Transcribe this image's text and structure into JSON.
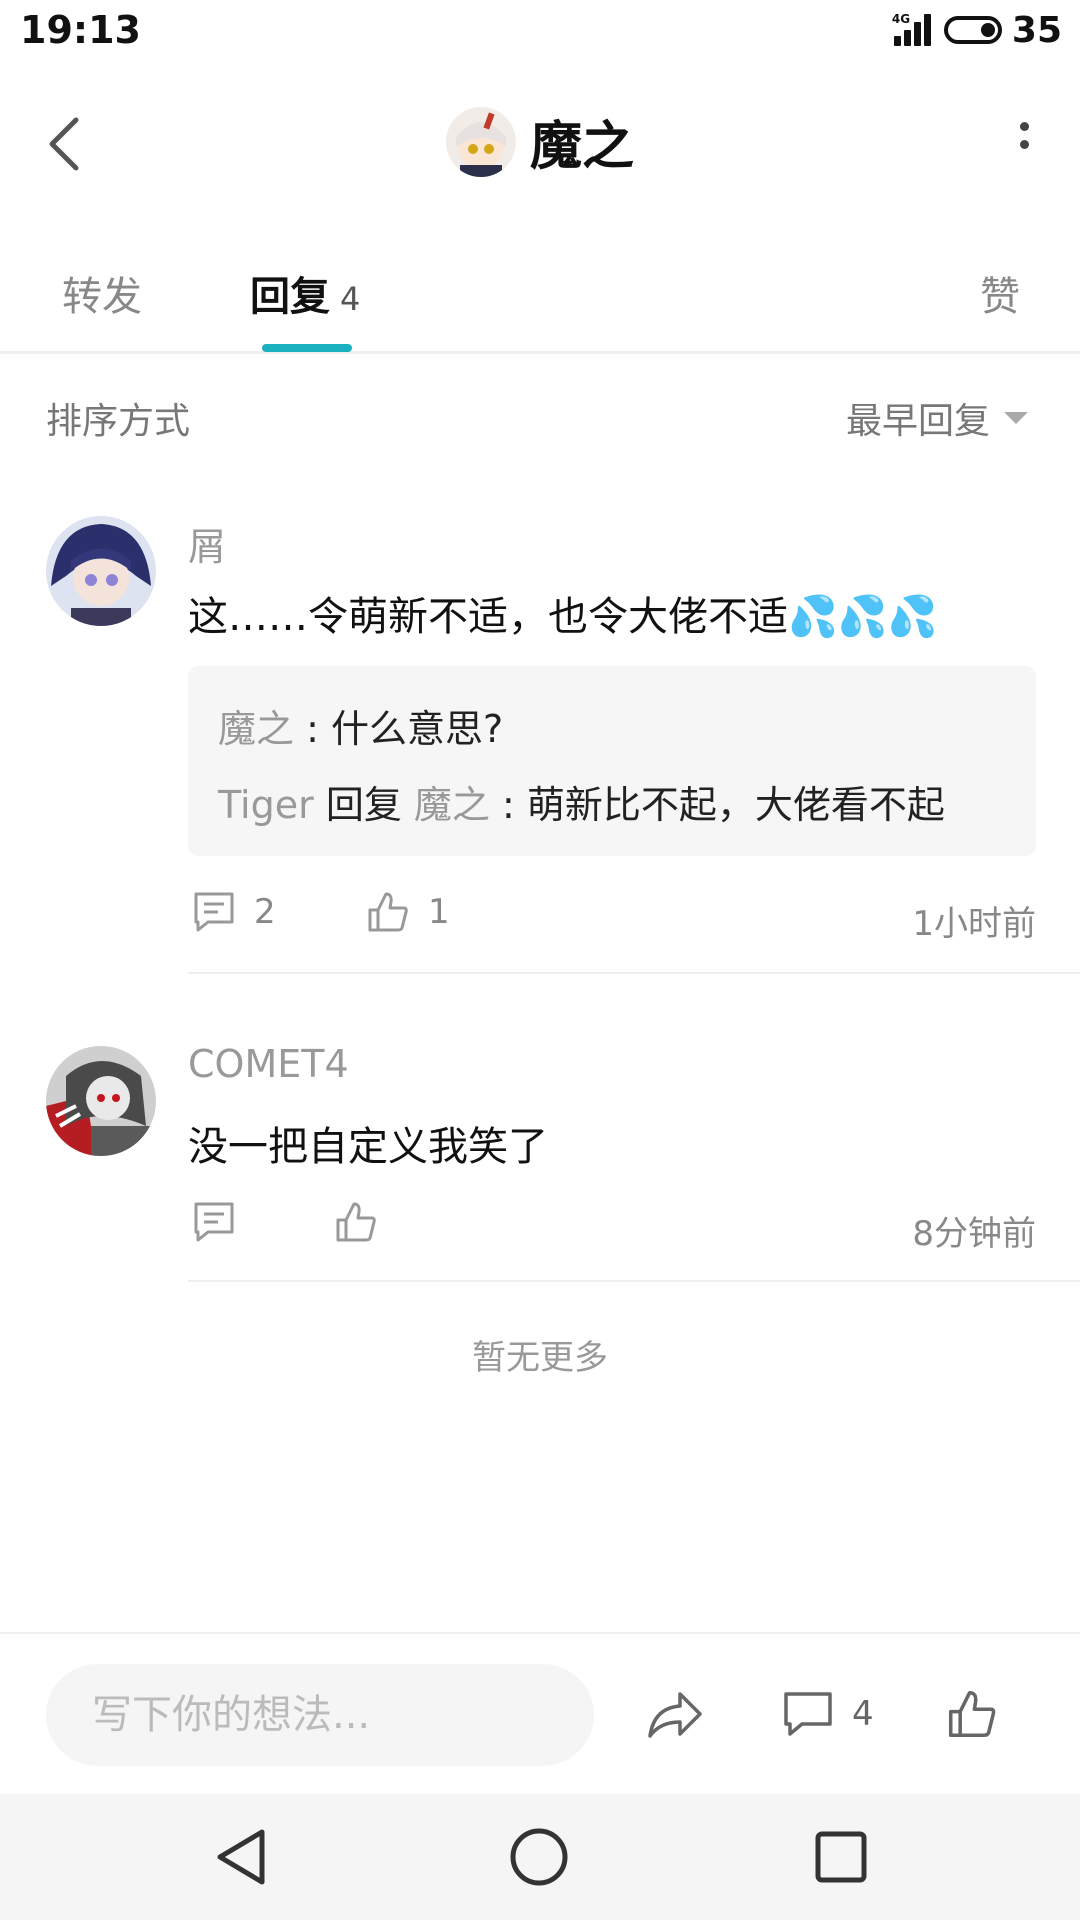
{
  "status_bar": {
    "time": "19:13",
    "network": "4G",
    "battery": "35"
  },
  "header": {
    "title": "魔之"
  },
  "tabs": [
    {
      "label": "转发"
    },
    {
      "label": "回复",
      "count": "4"
    },
    {
      "label": "赞"
    }
  ],
  "sort": {
    "label": "排序方式",
    "selected": "最早回复"
  },
  "comments": [
    {
      "user": "屑",
      "text": "这……令萌新不适，也令大佬不适💦💦💦",
      "replies": [
        {
          "user": "魔之",
          "sep": " : ",
          "text": "什么意思?"
        },
        {
          "user": "Tiger",
          "verb": " 回复 ",
          "target": "魔之",
          "sep": " : ",
          "text": "萌新比不起，大佬看不起"
        }
      ],
      "reply_count": "2",
      "like_count": "1",
      "time": "1小时前"
    },
    {
      "user": "COMET4",
      "text": "没一把自定义我笑了",
      "time": "8分钟前"
    }
  ],
  "footer_text": "暂无更多",
  "bottom_bar": {
    "input_placeholder": "写下你的想法...",
    "comment_count": "4"
  },
  "colors": {
    "accent": "#1ab0be",
    "muted": "#888888",
    "divider": "#eeeeee"
  }
}
